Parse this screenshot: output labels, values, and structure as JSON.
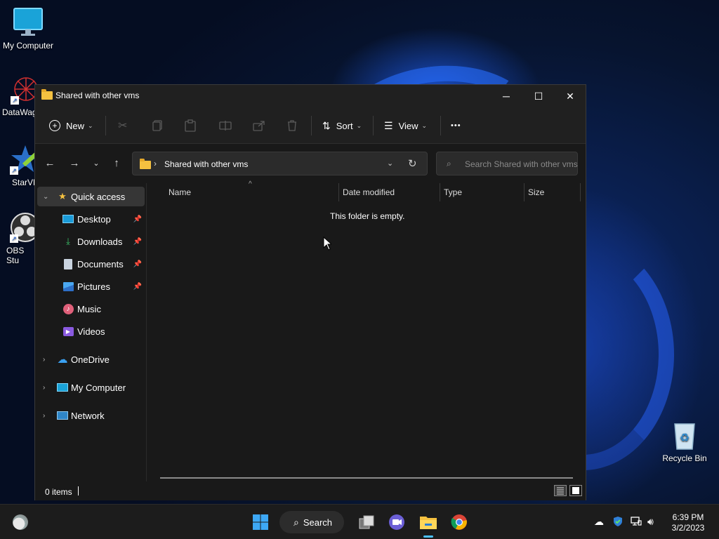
{
  "desktop": {
    "icons": [
      {
        "label": "My Computer"
      },
      {
        "label": "DataWag"
      },
      {
        "label": "StarVP"
      },
      {
        "label": "OBS Stu"
      },
      {
        "label": "Recycle Bin"
      }
    ]
  },
  "window": {
    "title": "Shared with other vms",
    "controls": {
      "minimize": "─",
      "maximize": "☐",
      "close": "✕"
    }
  },
  "toolbar": {
    "new_label": "New",
    "sort_label": "Sort",
    "view_label": "View",
    "more_label": "•••"
  },
  "address": {
    "path": "Shared with other vms",
    "search_placeholder": "Search Shared with other vms"
  },
  "nav": {
    "quick_access": "Quick access",
    "items": [
      {
        "label": "Desktop",
        "pinned": true
      },
      {
        "label": "Downloads",
        "pinned": true
      },
      {
        "label": "Documents",
        "pinned": true
      },
      {
        "label": "Pictures",
        "pinned": true
      },
      {
        "label": "Music",
        "pinned": false
      },
      {
        "label": "Videos",
        "pinned": false
      }
    ],
    "onedrive": "OneDrive",
    "my_computer": "My Computer",
    "network": "Network"
  },
  "columns": {
    "name": "Name",
    "date_modified": "Date modified",
    "type": "Type",
    "size": "Size"
  },
  "content": {
    "empty_message": "This folder is empty."
  },
  "status": {
    "item_count": "0 items"
  },
  "taskbar": {
    "search_label": "Search",
    "time": "6:39 PM",
    "date": "3/2/2023"
  },
  "colors": {
    "accent": "#4cc2ff",
    "folder": "#f5c140",
    "window_bg": "#191919",
    "taskbar_bg": "#1c1c1c"
  }
}
